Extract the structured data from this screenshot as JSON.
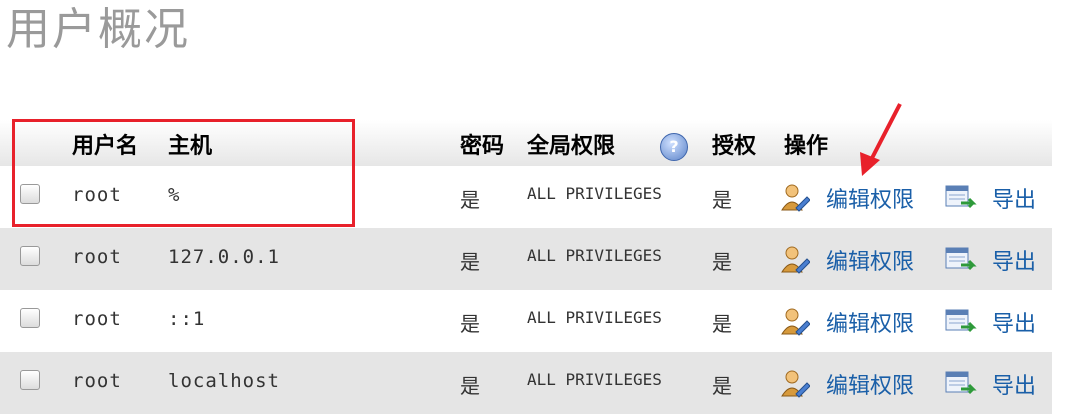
{
  "page": {
    "title": "用户概况"
  },
  "table": {
    "headers": {
      "user": "用户名",
      "host": "主机",
      "password": "密码",
      "global_privileges": "全局权限",
      "grant": "授权",
      "action": "操作"
    },
    "rows": [
      {
        "user": "root",
        "host": "%",
        "password": "是",
        "privileges": "ALL PRIVILEGES",
        "grant": "是",
        "edit": "编辑权限",
        "export": "导出"
      },
      {
        "user": "root",
        "host": "127.0.0.1",
        "password": "是",
        "privileges": "ALL PRIVILEGES",
        "grant": "是",
        "edit": "编辑权限",
        "export": "导出"
      },
      {
        "user": "root",
        "host": "::1",
        "password": "是",
        "privileges": "ALL PRIVILEGES",
        "grant": "是",
        "edit": "编辑权限",
        "export": "导出"
      },
      {
        "user": "root",
        "host": "localhost",
        "password": "是",
        "privileges": "ALL PRIVILEGES",
        "grant": "是",
        "edit": "编辑权限",
        "export": "导出"
      }
    ]
  },
  "colors": {
    "highlight": "#e8212b",
    "link": "#1a5fa8",
    "row_alt": "#e5e5e5"
  },
  "icons": {
    "help": "help-icon",
    "edit": "user-edit-icon",
    "export": "export-icon"
  }
}
